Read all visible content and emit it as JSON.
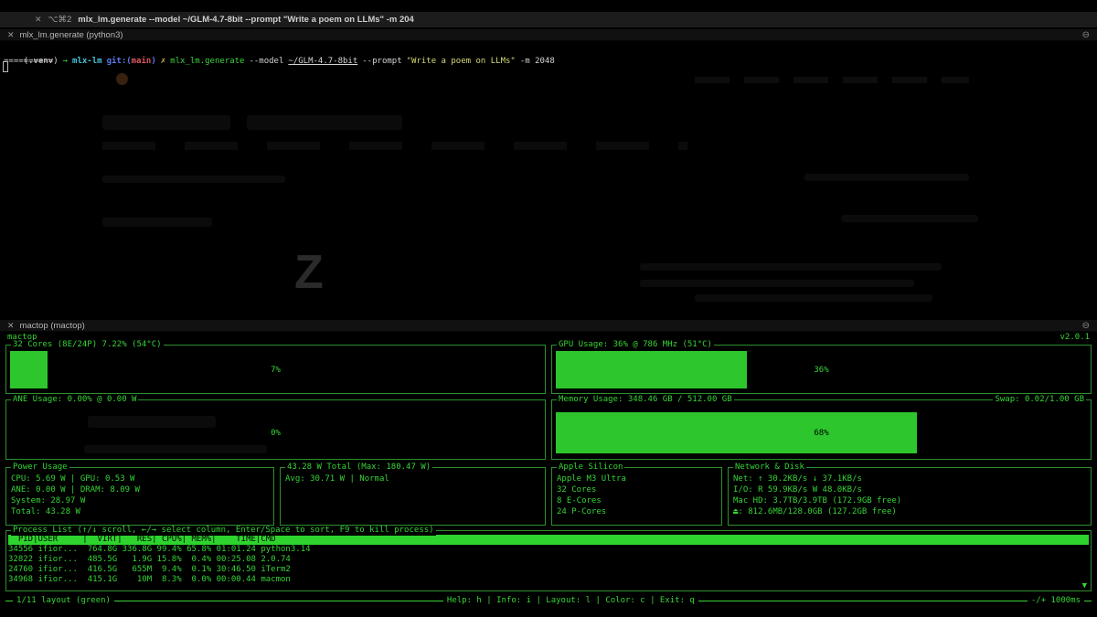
{
  "colors": {
    "terminal_green": "#35d435",
    "mactop_border": "#2d8f2d",
    "bar_fill": "#2dc62d",
    "process_header_bg": "#2ed32e",
    "prompt_cyan": "#45c5d8",
    "prompt_blue": "#5a7bf0",
    "prompt_red": "#e05561",
    "prompt_yellow": "#d7b96a",
    "command_green": "#3fd13f",
    "string_yellow": "#d8d878",
    "terminal_fg": "#d4d4d4"
  },
  "window": {
    "titlebar": {
      "close_icon": "✕",
      "shortcut": "⌥⌘2",
      "title": "mlx_lm.generate --model ~/GLM-4.7-8bit --prompt \"Write a poem on LLMs\" -m 204"
    },
    "top_pane_tab": {
      "close_icon": "✕",
      "label": "mlx_lm.generate (python3)",
      "menu_icon": "⊖"
    },
    "bottom_pane_tab": {
      "close_icon": "✕",
      "label": "mactop (mactop)",
      "menu_icon": "⊖"
    }
  },
  "terminal": {
    "prompt": {
      "venv": "(.venv)",
      "arrow": "→",
      "directory": "mlx-lm",
      "git_prefix": "git:(",
      "git_branch": "main",
      "git_suffix": ")",
      "git_dirty": "✗",
      "command": "mlx_lm.generate",
      "flag_model": "--model",
      "model_path": "~/GLM-4.7-8bit",
      "flag_prompt": "--prompt",
      "prompt_value": "\"Write a poem on LLMs\"",
      "flag_tokens": "-m 2048"
    },
    "output_line": "==========",
    "ghost_logo": "Z"
  },
  "mactop": {
    "app_title": "mactop",
    "version": "v2.0.1",
    "cpu_box": {
      "title": "32 Cores (8E/24P) 7.22% (54°C)",
      "percent": 7,
      "percent_label": "7%"
    },
    "gpu_box": {
      "title": "GPU Usage: 36% @ 786 MHz (51°C)",
      "percent": 36,
      "percent_label": "36%"
    },
    "ane_box": {
      "title": "ANE Usage: 0.00% @ 0.00 W",
      "percent": 0,
      "percent_label": "0%"
    },
    "memory_box": {
      "title": "Memory Usage: 348.46 GB / 512.00 GB",
      "swap_label": "Swap: 0.02/1.00 GB",
      "percent": 68,
      "percent_label": "68%"
    },
    "power_box": {
      "title": "Power Usage",
      "lines": [
        "CPU: 5.69 W | GPU: 0.53 W",
        "ANE: 0.00 W | DRAM: 8.09 W",
        "System: 28.97 W",
        "Total: 43.28 W"
      ]
    },
    "total_power_box": {
      "title": "43.28 W Total (Max: 180.47 W)",
      "lines": [
        "Avg: 30.71 W | Normal"
      ]
    },
    "silicon_box": {
      "title": "Apple Silicon",
      "lines": [
        "Apple M3 Ultra",
        "32 Cores",
        "8 E-Cores",
        "24 P-Cores"
      ]
    },
    "network_box": {
      "title": "Network & Disk",
      "lines": [
        "Net: ↑ 30.2KB/s ↓ 37.1KB/s",
        "I/O: R 59.9KB/s W 48.0KB/s",
        "Mac HD: 3.7TB/3.9TB (172.9GB free)",
        "⏏: 812.6MB/128.0GB (127.2GB free)"
      ]
    },
    "process_box": {
      "title": "Process List (↑/↓ scroll, ←/→ select column, Enter/Space to sort, F9 to kill process)",
      "header": "  PID|USER     |  VIRT|   RES| CPU%| MEM%|    TIME|CMD",
      "rows": [
        "34556 ifior...  764.8G 336.8G 99.4% 65.8% 01:01.24 python3.14",
        "32822 ifior...  485.5G   1.9G 15.8%  0.4% 00:25.08 2.0.74",
        "24760 ifior...  416.5G   655M  9.4%  0.1% 30:46.50 iTerm2",
        "34968 ifior...  415.1G    10M  8.3%  0.0% 00:00.44 macmon"
      ],
      "scroll_indicator": "▼"
    },
    "statusbar": {
      "left": "1/11 layout (green)",
      "help": "Help: h | Info: i | Layout: l | Color: c | Exit: q",
      "right": "-/+ 1000ms"
    }
  }
}
